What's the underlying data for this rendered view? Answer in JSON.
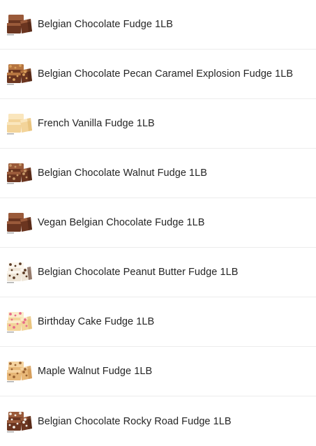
{
  "products": [
    {
      "name": "Belgian Chocolate Fudge 1LB",
      "image": "chocolate-fudge"
    },
    {
      "name": "Belgian Chocolate Pecan Caramel Explosion Fudge 1LB",
      "image": "pecan-caramel-fudge"
    },
    {
      "name": "French Vanilla Fudge 1LB",
      "image": "vanilla-fudge"
    },
    {
      "name": "Belgian Chocolate Walnut Fudge 1LB",
      "image": "chocolate-walnut-fudge"
    },
    {
      "name": "Vegan Belgian Chocolate Fudge 1LB",
      "image": "chocolate-fudge"
    },
    {
      "name": "Belgian Chocolate Peanut Butter Fudge 1LB",
      "image": "peanut-butter-fudge"
    },
    {
      "name": "Birthday Cake Fudge 1LB",
      "image": "birthday-cake-fudge"
    },
    {
      "name": "Maple Walnut Fudge 1LB",
      "image": "maple-walnut-fudge"
    },
    {
      "name": "Belgian Chocolate Rocky Road Fudge 1LB",
      "image": "rocky-road-fudge"
    }
  ],
  "colors": {
    "chocolate": "#6b3520",
    "chocolate_dark": "#4a2314",
    "chocolate_light": "#9a5a3a",
    "vanilla": "#f3d49a",
    "vanilla_dark": "#e2b86c",
    "maple": "#e7b777",
    "divider": "#ececec",
    "text": "#252525"
  }
}
